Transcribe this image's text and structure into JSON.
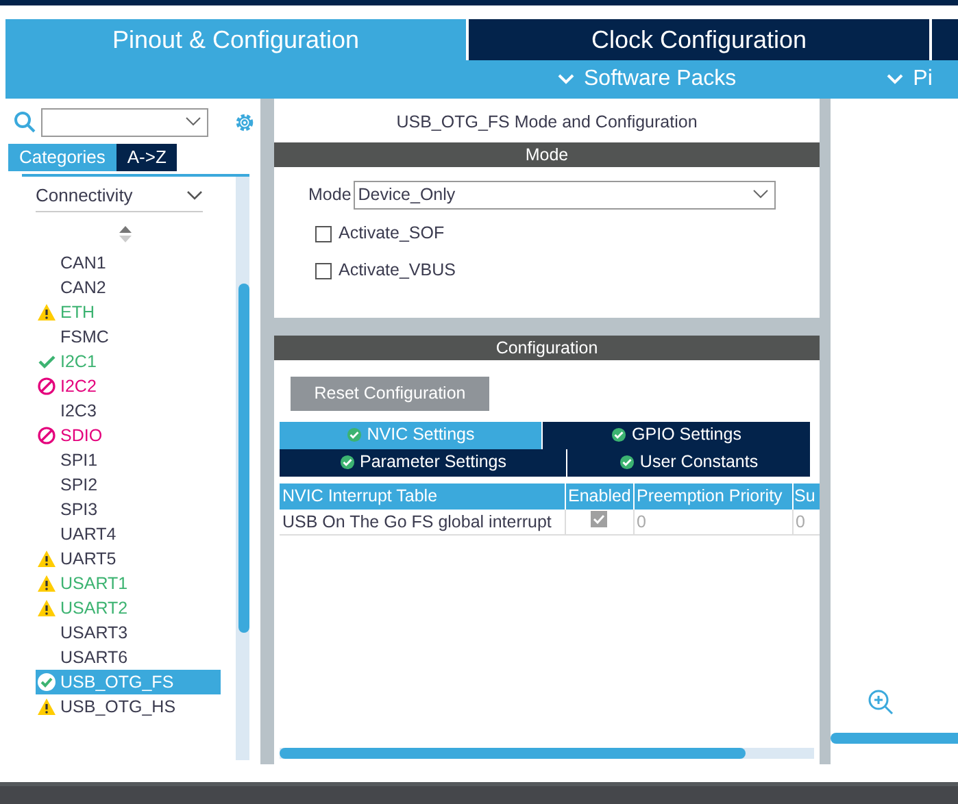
{
  "main_tabs": [
    {
      "label": "Pinout & Configuration",
      "selected": true
    },
    {
      "label": "Clock Configuration",
      "selected": false
    },
    {
      "selected": false
    }
  ],
  "sub_tabs": [
    {
      "label": "Software Packs"
    },
    {
      "label": "Pi"
    }
  ],
  "sidebar": {
    "view_tabs": [
      {
        "label": "Categories",
        "selected": true
      },
      {
        "label": "A->Z",
        "selected": false
      }
    ],
    "category": "Connectivity",
    "items": [
      {
        "label": "CAN1",
        "color": "#3b3b4f",
        "selected": false
      },
      {
        "label": "CAN2",
        "color": "#3b3b4f",
        "selected": false
      },
      {
        "label": "ETH",
        "kind": "warning",
        "color": "#3cb371",
        "selected": false
      },
      {
        "label": "FSMC",
        "color": "#3b3b4f",
        "selected": false
      },
      {
        "label": "I2C1",
        "kind": "ok",
        "color": "#3cb371",
        "selected": false
      },
      {
        "label": "I2C2",
        "kind": "blocked",
        "color": "#e4007c",
        "selected": false
      },
      {
        "label": "I2C3",
        "color": "#3b3b4f",
        "selected": false
      },
      {
        "label": "SDIO",
        "kind": "blocked",
        "color": "#e4007c",
        "selected": false
      },
      {
        "label": "SPI1",
        "color": "#3b3b4f",
        "selected": false
      },
      {
        "label": "SPI2",
        "color": "#3b3b4f",
        "selected": false
      },
      {
        "label": "SPI3",
        "color": "#3b3b4f",
        "selected": false
      },
      {
        "label": "UART4",
        "color": "#3b3b4f",
        "selected": false
      },
      {
        "label": "UART5",
        "kind": "warning",
        "color": "#3b3b4f",
        "selected": false
      },
      {
        "label": "USART1",
        "kind": "warning",
        "color": "#3cb371",
        "selected": false
      },
      {
        "label": "USART2",
        "kind": "warning",
        "color": "#3cb371",
        "selected": false
      },
      {
        "label": "USART3",
        "color": "#3b3b4f",
        "selected": false
      },
      {
        "label": "USART6",
        "color": "#3b3b4f",
        "selected": false
      },
      {
        "label": "USB_OTG_FS",
        "kind": "ok",
        "selected": true
      },
      {
        "label": "USB_OTG_HS",
        "kind": "warning",
        "color": "#3b3b4f",
        "selected": false
      }
    ]
  },
  "panel": {
    "title": "USB_OTG_FS Mode and Configuration",
    "mode_header": "Mode",
    "mode_label": "Mode",
    "mode_value": "Device_Only",
    "options": [
      {
        "label": "Activate_SOF",
        "checked": false
      },
      {
        "label": "Activate_VBUS",
        "checked": false
      }
    ],
    "config_header": "Configuration",
    "reset_button": "Reset Configuration",
    "config_tabs": [
      [
        {
          "label": "NVIC Settings",
          "selected": true
        },
        {
          "label": "GPIO Settings",
          "selected": false
        }
      ],
      [
        {
          "label": "Parameter Settings",
          "selected": false
        },
        {
          "label": "User Constants",
          "selected": false
        }
      ]
    ],
    "table": {
      "columns": [
        "NVIC Interrupt Table",
        "Enabled",
        "Preemption Priority",
        "Su"
      ],
      "rows": [
        {
          "name": "USB On The Go FS global interrupt",
          "enabled": true,
          "preemption": "0",
          "column_4": "0"
        }
      ]
    }
  }
}
